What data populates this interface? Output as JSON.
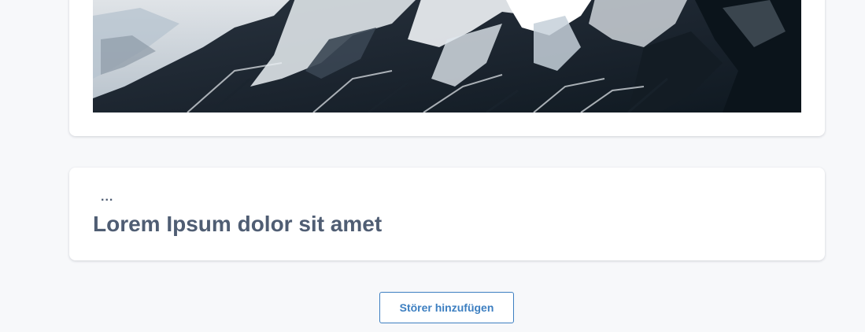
{
  "image_card": {
    "image_alt": "Snow-covered mountain range"
  },
  "text_card": {
    "ellipsis": "...",
    "headline": "Lorem Ipsum dolor sit amet"
  },
  "actions": {
    "add_label": "Störer hinzufügen"
  },
  "colors": {
    "page_background": "#f7f8fa",
    "text": "#4f5d73",
    "accent": "#3d7fc1"
  }
}
